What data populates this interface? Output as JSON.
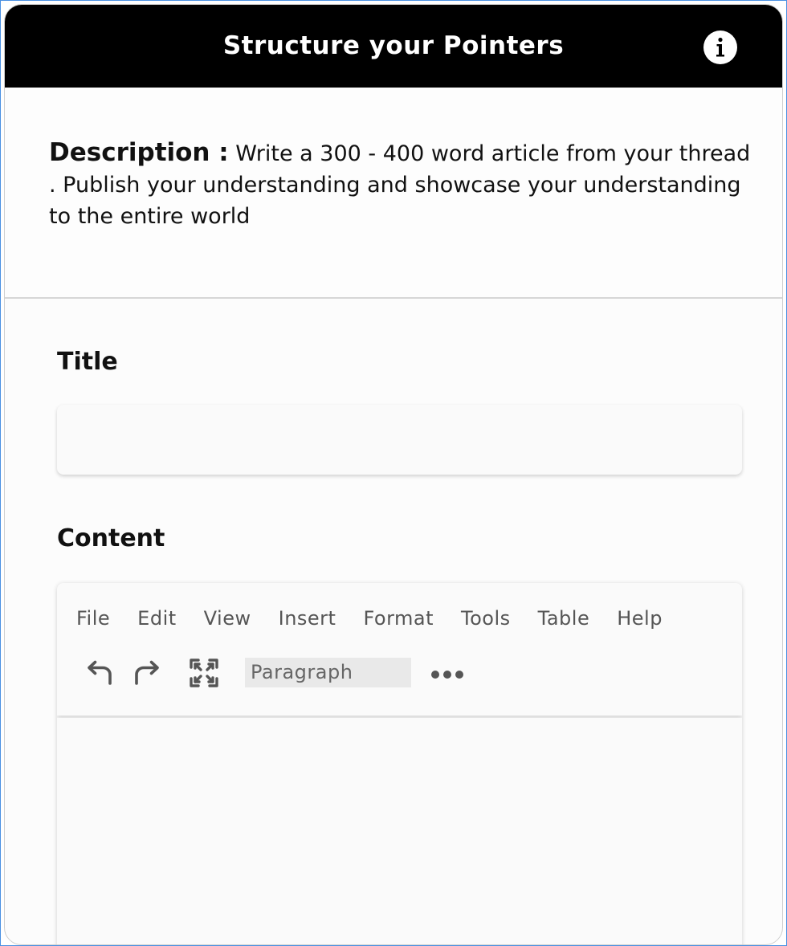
{
  "header": {
    "title": "Structure your Pointers",
    "info_icon": "info-icon"
  },
  "description": {
    "label": "Description :",
    "text": "Write a 300 - 400 word article from your thread . Publish your understanding and showcase your understanding to the entire world"
  },
  "form": {
    "title_label": "Title",
    "title_value": "",
    "content_label": "Content"
  },
  "editor": {
    "menu": [
      "File",
      "Edit",
      "View",
      "Insert",
      "Format",
      "Tools",
      "Table",
      "Help"
    ],
    "toolbar_icons": [
      "undo-icon",
      "redo-icon",
      "fullscreen-icon",
      "more-icon"
    ],
    "block_format": "Paragraph",
    "content": ""
  },
  "colors": {
    "header_bg": "#000000",
    "header_text": "#ffffff",
    "frame_border": "#4a90e2"
  }
}
